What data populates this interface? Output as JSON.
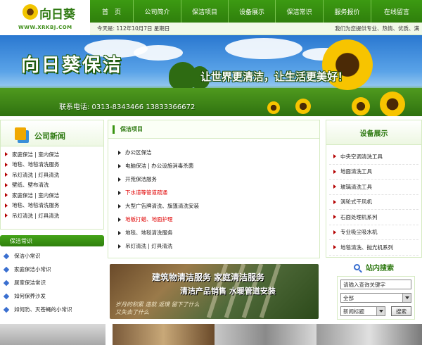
{
  "header": {
    "logo_text": "向日葵",
    "logo_url": "WWW.XRKBJ.COM"
  },
  "nav": {
    "items": [
      "首　页",
      "公司简介",
      "保洁项目",
      "设备展示",
      "保洁常识",
      "服务报价",
      "在线留言"
    ]
  },
  "info_bar": {
    "date_text": "今天是: 112年10月7日  星期日",
    "tagline": "我们为您提供专业、热情、优质、满"
  },
  "banner": {
    "title": "向日葵保洁",
    "slogan": "让世界更清洁，让生活更美好！",
    "phone": "联系电话: 0313-8343466  13833366672"
  },
  "news": {
    "title": "公司新闻",
    "items": [
      "家庭保洁 | 室内保洁",
      "地毯、地毯清洗服务",
      "吊灯清洗 | 灯具清洗",
      "壁纸、壁布清洗",
      "家庭保洁 | 室内保洁",
      "地毯、地毯清洗服务",
      "吊灯清洗 | 灯具清洗"
    ]
  },
  "tips": {
    "title": "保洁常识",
    "items": [
      "保洁小常识",
      "家庭保洁小常识",
      "居室保洁常识",
      "如何保养沙发",
      "如何防、灭苍蝇的小常识"
    ]
  },
  "services": {
    "title": "保洁项目",
    "items": [
      {
        "label": "办公区保洁",
        "highlight": false
      },
      {
        "label": "电脑保洁 | 办公设施消毒杀菌",
        "highlight": false
      },
      {
        "label": "开荒保洁服务",
        "highlight": false
      },
      {
        "label": "下水道等管道疏通",
        "highlight": true
      },
      {
        "label": "大型广告牌清洗、旗篷清洗安装",
        "highlight": false
      },
      {
        "label": "地板打蜡、地面护理",
        "highlight": true
      },
      {
        "label": "地毯、地毯清洗服务",
        "highlight": false
      },
      {
        "label": "吊灯清洗 | 灯具清洗",
        "highlight": false
      }
    ]
  },
  "promo": {
    "line1": "建筑物清洁服务  家庭清洁服务",
    "line2": "清洁产品销售  水暖管道安装",
    "caption": "岁月的积累  造就  返璞  留下了什么  又失去了什么"
  },
  "equipment": {
    "title": "设备展示",
    "items": [
      "中央空调清洗工具",
      "地面清洗工具",
      "玻璃清洗工具",
      "涡轮式干风机",
      "石面处理机系列",
      "专业吸尘吸水机",
      "地毯清洗、抛光机系列"
    ]
  },
  "search": {
    "title": "站内搜索",
    "placeholder": "请输入查询关键字",
    "category_selected": "全部",
    "field_selected": "新闻标题",
    "button_label": "搜索"
  },
  "colors": {
    "brand_green": "#2f7a12",
    "nav_green": "#3c9a12",
    "highlight_red": "#e00000"
  }
}
